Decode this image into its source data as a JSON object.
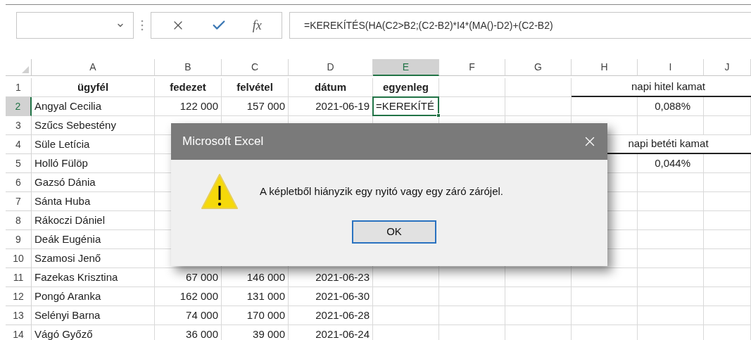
{
  "formula_bar": {
    "fx": "fx",
    "formula": "=KEREKÍTÉS(HA(C2>B2;(C2-B2)*I4*(MA()-D2)+(C2-B2)"
  },
  "columns": [
    {
      "label": "A",
      "selected": false
    },
    {
      "label": "B",
      "selected": false
    },
    {
      "label": "C",
      "selected": false
    },
    {
      "label": "D",
      "selected": false
    },
    {
      "label": "E",
      "selected": true
    },
    {
      "label": "F",
      "selected": false
    },
    {
      "label": "G",
      "selected": false
    },
    {
      "label": "H",
      "selected": false
    },
    {
      "label": "I",
      "selected": false
    },
    {
      "label": "J",
      "selected": false
    }
  ],
  "rows": [
    {
      "number": "1",
      "selected": false,
      "kind": "header",
      "A": "ügyfél",
      "B": "fedezet",
      "C": "felvétel",
      "D": "dátum",
      "E": "egyenleg",
      "HJ": "napi hitel kamat"
    },
    {
      "number": "2",
      "selected": true,
      "A": "Angyal Cecilia",
      "B": "122 000",
      "C": "157 000",
      "D": "2021-06-19",
      "E": "=KEREKÍTÉ",
      "I": "0,088%"
    },
    {
      "number": "3",
      "selected": false,
      "A": "Szűcs Sebestény"
    },
    {
      "number": "4",
      "selected": false,
      "A": "Süle Letícia",
      "HJ": "napi betéti kamat"
    },
    {
      "number": "5",
      "selected": false,
      "A": "Holló Fülöp",
      "I": "0,044%"
    },
    {
      "number": "6",
      "selected": false,
      "A": "Gazsó Dánia"
    },
    {
      "number": "7",
      "selected": false,
      "A": "Sánta Huba"
    },
    {
      "number": "8",
      "selected": false,
      "A": "Rákoczi Dániel"
    },
    {
      "number": "9",
      "selected": false,
      "A": "Deák Eugénia"
    },
    {
      "number": "10",
      "selected": false,
      "A": "Szamosi Jenő"
    },
    {
      "number": "11",
      "selected": false,
      "A": "Fazekas Krisztina",
      "B": "67 000",
      "C": "146 000",
      "D": "2021-06-23"
    },
    {
      "number": "12",
      "selected": false,
      "A": "Pongó Aranka",
      "B": "162 000",
      "C": "131 000",
      "D": "2021-06-30"
    },
    {
      "number": "13",
      "selected": false,
      "A": "Selényi Barna",
      "B": "74 000",
      "C": "170 000",
      "D": "2021-06-28"
    },
    {
      "number": "14",
      "selected": false,
      "A": "Vágó Győző",
      "B": "36 000",
      "C": "39 000",
      "D": "2021-06-24"
    }
  ],
  "dialog": {
    "title": "Microsoft Excel",
    "message": "A képletből hiányzik egy nyitó vagy egy záró zárójel.",
    "buttons": [
      "OK"
    ]
  }
}
